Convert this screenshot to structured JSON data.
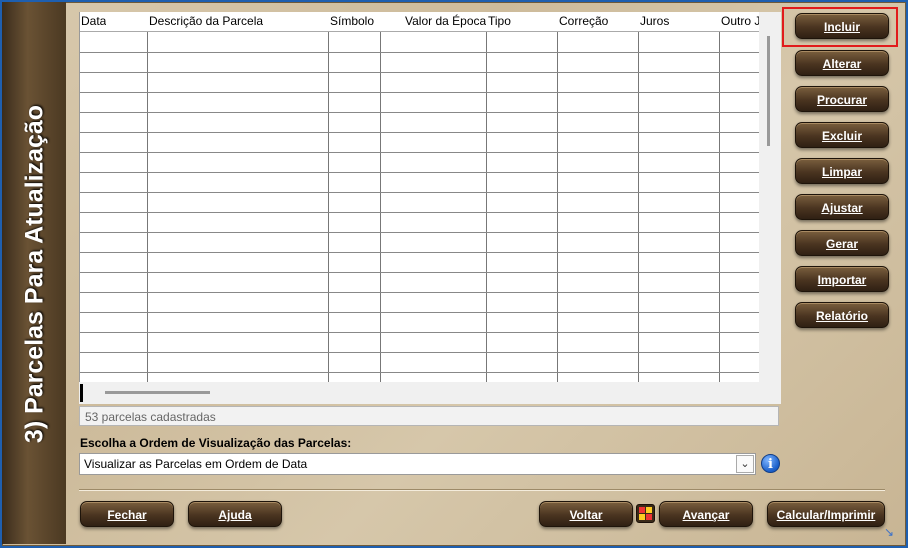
{
  "side_title": "3) Parcelas Para Atualização",
  "table": {
    "columns": [
      "Data",
      "Descrição da Parcela",
      "Símbolo",
      "Valor da Época",
      "Tipo",
      "Correção",
      "Juros",
      "Outro J"
    ]
  },
  "status": "53 parcelas cadastradas",
  "order": {
    "label": "Escolha a Ordem de Visualização das Parcelas:",
    "selected": "Visualizar as Parcelas em Ordem de Data",
    "info_icon": "i"
  },
  "actions": {
    "incluir": "Incluir",
    "alterar": "Alterar",
    "procurar": "Procurar",
    "excluir": "Excluir",
    "limpar": "Limpar",
    "ajustar": "Ajustar",
    "gerar": "Gerar",
    "importar": "Importar",
    "relatorio": "Relatório"
  },
  "footer": {
    "fechar": "Fechar",
    "ajuda": "Ajuda",
    "voltar": "Voltar",
    "avancar": "Avançar",
    "calcular": "Calcular/Imprimir"
  },
  "colors": {
    "panel_bg": "#d4c5a8",
    "button_dark": "#4a3420",
    "focus": "#e11b1b"
  }
}
